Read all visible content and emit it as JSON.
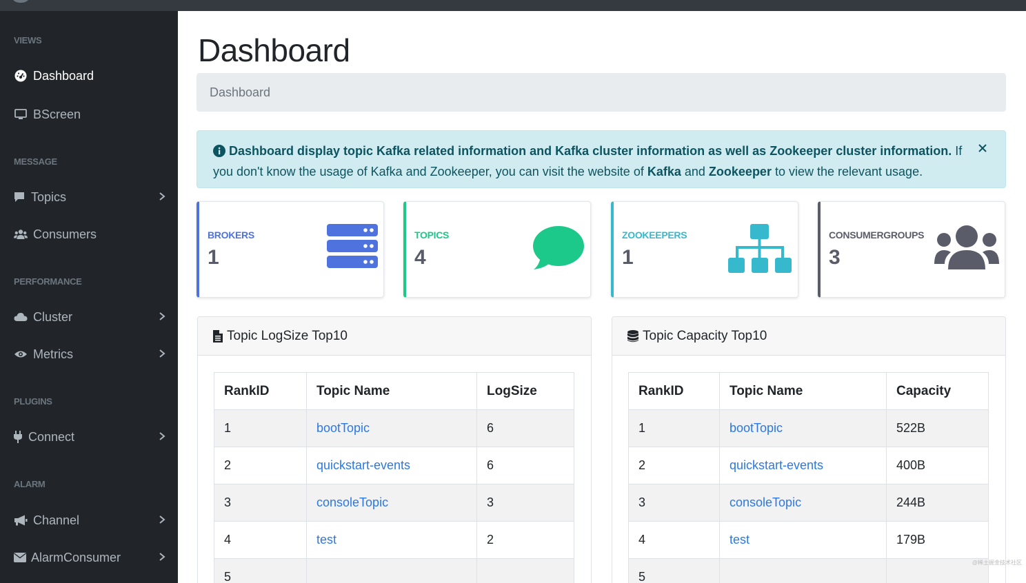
{
  "sidebar": {
    "sections": [
      {
        "heading": "VIEWS"
      },
      {
        "heading": "MESSAGE"
      },
      {
        "heading": "PERFORMANCE"
      },
      {
        "heading": "PLUGINS"
      },
      {
        "heading": "ALARM"
      }
    ],
    "items": [
      {
        "label": "Dashboard",
        "icon": "dashboard-icon",
        "active": true
      },
      {
        "label": "BScreen",
        "icon": "monitor-icon"
      },
      {
        "label": "Topics",
        "icon": "comment-icon"
      },
      {
        "label": "Consumers",
        "icon": "users-icon"
      },
      {
        "label": "Cluster",
        "icon": "cloud-icon"
      },
      {
        "label": "Metrics",
        "icon": "eye-icon"
      },
      {
        "label": "Connect",
        "icon": "plug-icon"
      },
      {
        "label": "Channel",
        "icon": "bullhorn-icon"
      },
      {
        "label": "AlarmConsumer",
        "icon": "envelope-icon"
      }
    ]
  },
  "page": {
    "title": "Dashboard",
    "breadcrumb": "Dashboard"
  },
  "alert": {
    "bold_text": "Dashboard display topic Kafka related information and Kafka cluster information as well as Zookeeper cluster information.",
    "text_1": " If you don't know the usage of Kafka and Zookeeper, you can visit the website of ",
    "link_kafka": "Kafka",
    "text_2": " and ",
    "link_zookeeper": "Zookeeper",
    "text_3": " to view the relevant usage."
  },
  "cards": [
    {
      "label": "BROKERS",
      "value": "1",
      "color": "#4e73df",
      "icon": "server-icon"
    },
    {
      "label": "TOPICS",
      "value": "4",
      "color": "#1cc88a",
      "icon": "comment-icon"
    },
    {
      "label": "ZOOKEEPERS",
      "value": "1",
      "color": "#36b9cc",
      "icon": "sitemap-icon"
    },
    {
      "label": "CONSUMERGROUPS",
      "value": "3",
      "color": "#5a5c69",
      "icon": "users-icon"
    }
  ],
  "logsize_panel": {
    "title": "Topic LogSize Top10",
    "columns": [
      "RankID",
      "Topic Name",
      "LogSize"
    ],
    "rows": [
      [
        "1",
        "bootTopic",
        "6"
      ],
      [
        "2",
        "quickstart-events",
        "6"
      ],
      [
        "3",
        "consoleTopic",
        "3"
      ],
      [
        "4",
        "test",
        "2"
      ],
      [
        "5",
        "",
        ""
      ]
    ]
  },
  "capacity_panel": {
    "title": "Topic Capacity Top10",
    "columns": [
      "RankID",
      "Topic Name",
      "Capacity"
    ],
    "rows": [
      [
        "1",
        "bootTopic",
        "522B"
      ],
      [
        "2",
        "quickstart-events",
        "400B"
      ],
      [
        "3",
        "consoleTopic",
        "244B"
      ],
      [
        "4",
        "test",
        "179B"
      ],
      [
        "5",
        "",
        ""
      ]
    ]
  },
  "watermark": "@稀土掘金技术社区"
}
